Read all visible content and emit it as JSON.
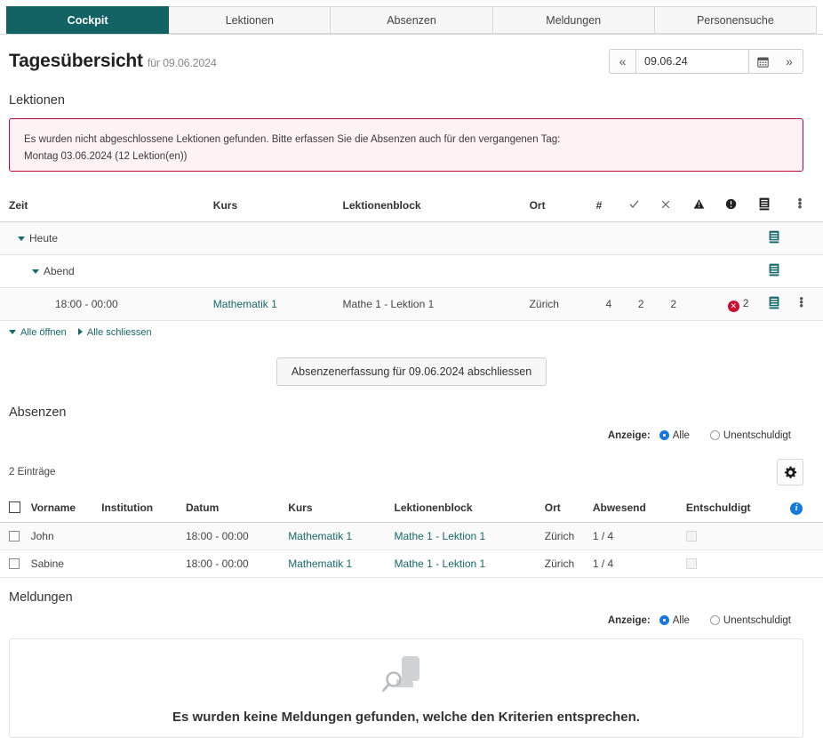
{
  "tabs": [
    {
      "label": "Cockpit",
      "active": true
    },
    {
      "label": "Lektionen",
      "active": false
    },
    {
      "label": "Absenzen",
      "active": false
    },
    {
      "label": "Meldungen",
      "active": false
    },
    {
      "label": "Personensuche",
      "active": false
    }
  ],
  "header": {
    "title": "Tagesübersicht",
    "subtitle": "für 09.06.2024",
    "date_value": "09.06.24",
    "prev_label": "«",
    "next_label": "»",
    "calendar_icon": "calendar-icon"
  },
  "lektionen": {
    "heading": "Lektionen",
    "alert": {
      "line1": "Es wurden nicht abgeschlossene Lektionen gefunden. Bitte erfassen Sie die Absenzen auch für den vergangenen Tag:",
      "line2": "Montag 03.06.2024 (12 Lektion(en))",
      "border_color": "#c3083b",
      "background_color": "#fdf2f4"
    },
    "columns": {
      "zeit": "Zeit",
      "kurs": "Kurs",
      "block": "Lektionenblock",
      "ort": "Ort",
      "hash": "#",
      "check": "✓",
      "cross": "×",
      "warning": "warning-icon",
      "info": "info-icon",
      "book": "book-icon",
      "menu": "kebab-menu-icon"
    },
    "groups": [
      {
        "label": "Heute",
        "level": 1
      },
      {
        "label": "Abend",
        "level": 2
      }
    ],
    "rows": [
      {
        "zeit": "18:00 - 00:00",
        "kurs": "Mathematik 1",
        "block": "Mathe 1 - Lektion 1",
        "ort": "Zürich",
        "hash": "4",
        "check": "2",
        "cross": "2",
        "warning": "",
        "info_count": "2"
      }
    ],
    "expand_all": "Alle öffnen",
    "collapse_all": "Alle schliessen",
    "finish_button": "Absenzenerfassung für 09.06.2024 abschliessen"
  },
  "absenzen": {
    "heading": "Absenzen",
    "filter": {
      "label": "Anzeige:",
      "options": [
        {
          "label": "Alle",
          "selected": true
        },
        {
          "label": "Unentschuldigt",
          "selected": false
        }
      ]
    },
    "count": "2 Einträge",
    "settings_icon": "gear-icon",
    "columns": {
      "select": "select-all-checkbox",
      "vorname": "Vorname",
      "institution": "Institution",
      "datum": "Datum",
      "kurs": "Kurs",
      "block": "Lektionenblock",
      "ort": "Ort",
      "abwesend": "Abwesend",
      "entschuldigt": "Entschuldigt",
      "info": "info-icon"
    },
    "rows": [
      {
        "vorname": "John",
        "institution": "",
        "datum": "18:00 - 00:00",
        "kurs": "Mathematik 1",
        "block": "Mathe 1 - Lektion 1",
        "ort": "Zürich",
        "abwesend": "1 / 4",
        "entschuldigt": false
      },
      {
        "vorname": "Sabine",
        "institution": "",
        "datum": "18:00 - 00:00",
        "kurs": "Mathematik 1",
        "block": "Mathe 1 - Lektion 1",
        "ort": "Zürich",
        "abwesend": "1 / 4",
        "entschuldigt": false
      }
    ]
  },
  "meldungen": {
    "heading": "Meldungen",
    "filter": {
      "label": "Anzeige:",
      "options": [
        {
          "label": "Alle",
          "selected": true
        },
        {
          "label": "Unentschuldigt",
          "selected": false
        }
      ]
    },
    "empty_message": "Es wurden keine Meldungen gefunden, welche den Kriterien entsprechen.",
    "empty_icon": "search-document-icon"
  },
  "colors": {
    "accent_teal": "#136365",
    "link_teal": "#17686b",
    "alert_red": "#c3083b",
    "badge_red": "#cc0a2f",
    "radio_blue": "#1778e0"
  }
}
